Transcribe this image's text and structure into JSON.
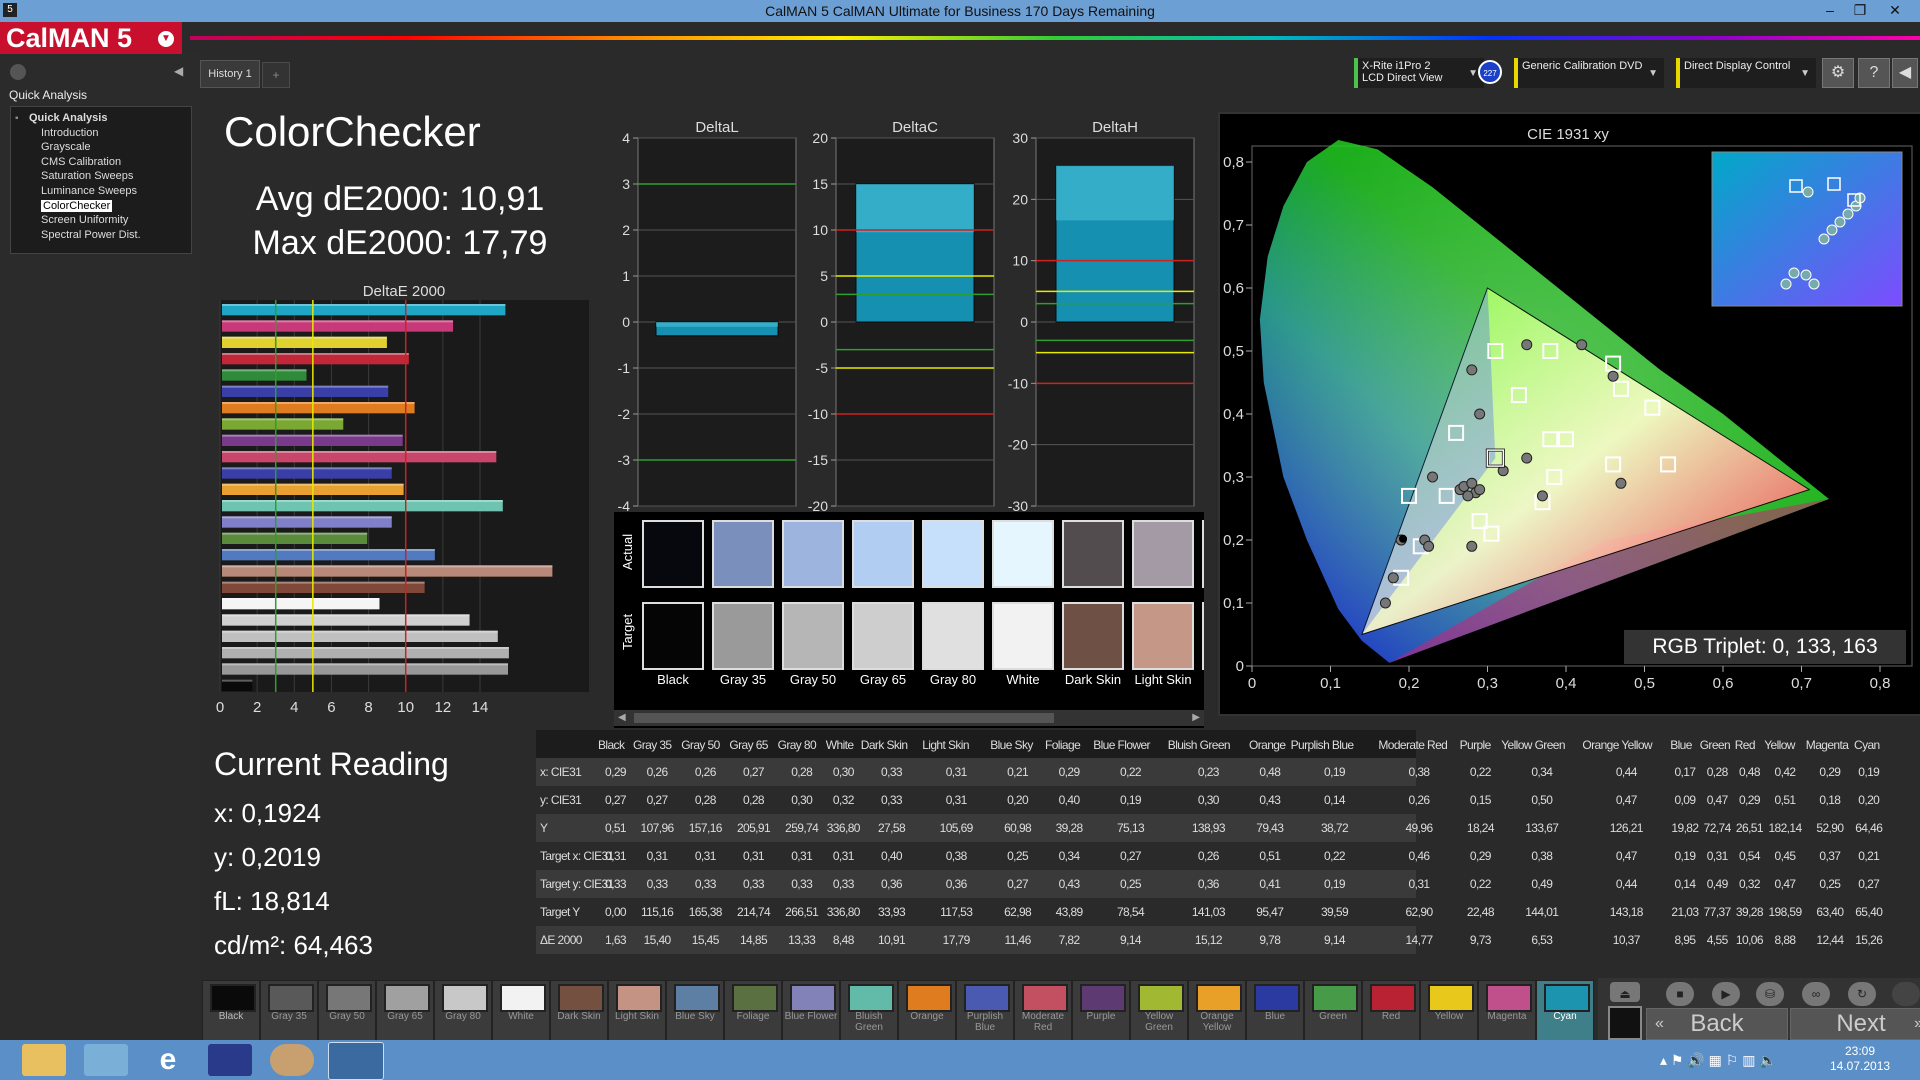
{
  "window": {
    "title": "CalMAN 5 CalMAN Ultimate for Business 170 Days Remaining",
    "app_logo": "CalMAN 5"
  },
  "tabs": [
    {
      "label": "History 1"
    }
  ],
  "sidebar": {
    "header": "Quick Analysis",
    "group": "Quick Analysis",
    "items": [
      {
        "label": "Introduction"
      },
      {
        "label": "Grayscale"
      },
      {
        "label": "CMS Calibration"
      },
      {
        "label": "Saturation Sweeps"
      },
      {
        "label": "Luminance Sweeps"
      },
      {
        "label": "ColorChecker",
        "selected": true
      },
      {
        "label": "Screen Uniformity"
      },
      {
        "label": "Spectral Power Dist."
      }
    ]
  },
  "devices": {
    "meter": {
      "line1": "X-Rite i1Pro 2",
      "line2": "LCD Direct View",
      "badge": "227"
    },
    "source": {
      "label": "Generic Calibration DVD"
    },
    "display": {
      "label": "Direct Display Control"
    }
  },
  "page": {
    "title": "ColorChecker",
    "avg_de": "Avg dE2000: 10,91",
    "max_de": "Max dE2000: 17,79"
  },
  "current_reading": {
    "title": "Current Reading",
    "x": "x: 0,1924",
    "y": "y: 0,2019",
    "fl": "fL: 18,814",
    "cdm2": "cd/m²: 64,463"
  },
  "rgb_triplet": "RGB Triplet: 0, 133, 163",
  "swatches": {
    "actual_label": "Actual",
    "target_label": "Target",
    "items": [
      {
        "name": "Black",
        "actual": "#07080d",
        "target": "#050505"
      },
      {
        "name": "Gray 35",
        "actual": "#7b8fbd",
        "target": "#9a9a9a"
      },
      {
        "name": "Gray 50",
        "actual": "#9db4df",
        "target": "#b6b6b6"
      },
      {
        "name": "Gray 65",
        "actual": "#b2cdf2",
        "target": "#cecece"
      },
      {
        "name": "Gray 80",
        "actual": "#c6e0fc",
        "target": "#e0e0e0"
      },
      {
        "name": "White",
        "actual": "#e5f6ff",
        "target": "#f2f2f2"
      },
      {
        "name": "Dark Skin",
        "actual": "#534c4f",
        "target": "#6e5144"
      },
      {
        "name": "Light Skin",
        "actual": "#a39aa6",
        "target": "#c49787"
      }
    ]
  },
  "chart_data": [
    {
      "type": "bar",
      "title": "DeltaE 2000",
      "orientation": "horizontal",
      "xlim": [
        0,
        15
      ],
      "xticks": [
        "0",
        "2",
        "4",
        "6",
        "8",
        "10",
        "12",
        "14"
      ],
      "reference_lines": [
        {
          "value": 3,
          "color": "#2e9e2e"
        },
        {
          "value": 5,
          "color": "#e8e800"
        },
        {
          "value": 10,
          "color": "#cc2222"
        }
      ],
      "series": [
        {
          "values": [
            1.63,
            15.4,
            15.45,
            14.85,
            13.33,
            8.48,
            10.91,
            17.79,
            11.46,
            7.82,
            9.14,
            15.12,
            9.78,
            9.14,
            14.77,
            9.73,
            6.53,
            10.37,
            8.95,
            4.55,
            10.06,
            8.88,
            12.44,
            15.26
          ]
        }
      ],
      "bar_colors_top_to_bottom": [
        "#1fa6c4",
        "#c8397a",
        "#e0d030",
        "#c0283a",
        "#2f8a3a",
        "#3a3fa8",
        "#e07c20",
        "#7aa832",
        "#7a3a8c",
        "#c8466a",
        "#3a3fa8",
        "#e8a030",
        "#6ec4b0",
        "#8080c8",
        "#5a8a3c",
        "#527ac0",
        "#b88878",
        "#804838",
        "#f5f5f5",
        "#d0d0d0",
        "#c0c0c0",
        "#b0b0b0",
        "#989898",
        "#0a0a0a"
      ],
      "bar_values_top_to_bottom": [
        15.26,
        12.44,
        8.88,
        10.06,
        4.55,
        8.95,
        10.37,
        6.53,
        9.73,
        14.77,
        9.14,
        9.78,
        15.12,
        9.14,
        7.82,
        11.46,
        17.79,
        10.91,
        8.48,
        13.33,
        14.85,
        15.45,
        15.4,
        1.63
      ]
    },
    {
      "type": "bar",
      "title": "DeltaL",
      "ylim": [
        -4,
        4
      ],
      "yticks": [
        "4",
        "3",
        "2",
        "1",
        "0",
        "-1",
        "-2",
        "-3",
        "-4"
      ],
      "values": [
        -0.3
      ],
      "reference_lines": [
        {
          "value": 3,
          "color": "#2e9e2e"
        },
        {
          "value": -3,
          "color": "#2e9e2e"
        }
      ]
    },
    {
      "type": "bar",
      "title": "DeltaC",
      "ylim": [
        -20,
        20
      ],
      "yticks": [
        "20",
        "15",
        "10",
        "5",
        "0",
        "-5",
        "-10",
        "-15",
        "-20"
      ],
      "values": [
        15
      ],
      "reference_lines": [
        {
          "value": 10,
          "color": "#cc2222"
        },
        {
          "value": 5,
          "color": "#e8e800"
        },
        {
          "value": 3,
          "color": "#2e9e2e"
        },
        {
          "value": -3,
          "color": "#2e9e2e"
        },
        {
          "value": -5,
          "color": "#e8e800"
        },
        {
          "value": -10,
          "color": "#cc2222"
        }
      ]
    },
    {
      "type": "bar",
      "title": "DeltaH",
      "ylim": [
        -30,
        30
      ],
      "yticks": [
        "30",
        "20",
        "10",
        "0",
        "-10",
        "-20",
        "-30"
      ],
      "values": [
        25.5
      ],
      "reference_lines": [
        {
          "value": 10,
          "color": "#cc2222"
        },
        {
          "value": 5,
          "color": "#e8e800"
        },
        {
          "value": 3,
          "color": "#2e9e2e"
        },
        {
          "value": -3,
          "color": "#2e9e2e"
        },
        {
          "value": -5,
          "color": "#e8e800"
        },
        {
          "value": -10,
          "color": "#cc2222"
        }
      ]
    },
    {
      "type": "scatter",
      "title": "CIE 1931 xy",
      "xlim": [
        0,
        0.8
      ],
      "ylim": [
        0,
        0.85
      ],
      "xticks": [
        "0",
        "0,1",
        "0,2",
        "0,3",
        "0,4",
        "0,5",
        "0,6",
        "0,7",
        "0,8"
      ],
      "yticks": [
        "0",
        "0,1",
        "0,2",
        "0,3",
        "0,4",
        "0,5",
        "0,6",
        "0,7",
        "0,8"
      ],
      "gamut_primaries": {
        "red": [
          0.71,
          0.28
        ],
        "green": [
          0.3,
          0.6
        ],
        "blue": [
          0.14,
          0.05
        ]
      },
      "targets": [
        [
          0.31,
          0.33
        ],
        [
          0.385,
          0.3
        ],
        [
          0.248,
          0.27
        ],
        [
          0.31,
          0.5
        ],
        [
          0.38,
          0.5
        ],
        [
          0.46,
          0.48
        ],
        [
          0.34,
          0.43
        ],
        [
          0.47,
          0.44
        ],
        [
          0.51,
          0.41
        ],
        [
          0.26,
          0.37
        ],
        [
          0.38,
          0.36
        ],
        [
          0.4,
          0.36
        ],
        [
          0.46,
          0.32
        ],
        [
          0.53,
          0.32
        ],
        [
          0.2,
          0.27
        ],
        [
          0.29,
          0.23
        ],
        [
          0.37,
          0.26
        ],
        [
          0.215,
          0.19
        ],
        [
          0.19,
          0.14
        ],
        [
          0.305,
          0.21
        ]
      ],
      "actuals": [
        [
          0.35,
          0.51
        ],
        [
          0.42,
          0.51
        ],
        [
          0.28,
          0.47
        ],
        [
          0.46,
          0.46
        ],
        [
          0.29,
          0.4
        ],
        [
          0.35,
          0.33
        ],
        [
          0.32,
          0.31
        ],
        [
          0.47,
          0.29
        ],
        [
          0.23,
          0.3
        ],
        [
          0.265,
          0.28
        ],
        [
          0.27,
          0.285
        ],
        [
          0.28,
          0.29
        ],
        [
          0.285,
          0.275
        ],
        [
          0.29,
          0.28
        ],
        [
          0.19,
          0.2
        ],
        [
          0.22,
          0.2
        ],
        [
          0.18,
          0.14
        ],
        [
          0.225,
          0.19
        ],
        [
          0.17,
          0.1
        ],
        [
          0.28,
          0.19
        ],
        [
          0.37,
          0.27
        ],
        [
          0.19,
          0.2
        ],
        [
          0.275,
          0.27
        ]
      ],
      "current_point": [
        0.1924,
        0.2019
      ],
      "current_target": [
        0.31,
        0.33
      ]
    }
  ],
  "table": {
    "columns": [
      "Black",
      "Gray 35",
      "Gray 50",
      "Gray 65",
      "Gray 80",
      "White",
      "Dark Skin",
      "Light Skin",
      "Blue Sky",
      "Foliage",
      "Blue Flower",
      "Bluish Green",
      "Orange",
      "Purplish Blue",
      "Moderate Red",
      "Purple",
      "Yellow Green",
      "Orange Yellow",
      "Blue",
      "Green",
      "Red",
      "Yellow",
      "Magenta",
      "Cyan"
    ],
    "rows": [
      {
        "label": "x: CIE31",
        "values": [
          "0,29",
          "0,26",
          "0,26",
          "0,27",
          "0,28",
          "0,30",
          "0,33",
          "0,31",
          "0,21",
          "0,29",
          "0,22",
          "0,23",
          "0,48",
          "0,19",
          "0,38",
          "0,22",
          "0,34",
          "0,44",
          "0,17",
          "0,28",
          "0,48",
          "0,42",
          "0,29",
          "0,19"
        ]
      },
      {
        "label": "y: CIE31",
        "values": [
          "0,27",
          "0,27",
          "0,28",
          "0,28",
          "0,30",
          "0,32",
          "0,33",
          "0,31",
          "0,20",
          "0,40",
          "0,19",
          "0,30",
          "0,43",
          "0,14",
          "0,26",
          "0,15",
          "0,50",
          "0,47",
          "0,09",
          "0,47",
          "0,29",
          "0,51",
          "0,18",
          "0,20"
        ]
      },
      {
        "label": "Y",
        "values": [
          "0,51",
          "107,96",
          "157,16",
          "205,91",
          "259,74",
          "336,80",
          "27,58",
          "105,69",
          "60,98",
          "39,28",
          "75,13",
          "138,93",
          "79,43",
          "38,72",
          "49,96",
          "18,24",
          "133,67",
          "126,21",
          "19,82",
          "72,74",
          "26,51",
          "182,14",
          "52,90",
          "64,46"
        ]
      },
      {
        "label": "Target x: CIE31",
        "values": [
          "0,31",
          "0,31",
          "0,31",
          "0,31",
          "0,31",
          "0,31",
          "0,40",
          "0,38",
          "0,25",
          "0,34",
          "0,27",
          "0,26",
          "0,51",
          "0,22",
          "0,46",
          "0,29",
          "0,38",
          "0,47",
          "0,19",
          "0,31",
          "0,54",
          "0,45",
          "0,37",
          "0,21"
        ]
      },
      {
        "label": "Target y: CIE31",
        "values": [
          "0,33",
          "0,33",
          "0,33",
          "0,33",
          "0,33",
          "0,33",
          "0,36",
          "0,36",
          "0,27",
          "0,43",
          "0,25",
          "0,36",
          "0,41",
          "0,19",
          "0,31",
          "0,22",
          "0,49",
          "0,44",
          "0,14",
          "0,49",
          "0,32",
          "0,47",
          "0,25",
          "0,27"
        ]
      },
      {
        "label": "Target Y",
        "values": [
          "0,00",
          "115,16",
          "165,38",
          "214,74",
          "266,51",
          "336,80",
          "33,93",
          "117,53",
          "62,98",
          "43,89",
          "78,54",
          "141,03",
          "95,47",
          "39,59",
          "62,90",
          "22,48",
          "144,01",
          "143,18",
          "21,03",
          "77,37",
          "39,28",
          "198,59",
          "63,40",
          "65,40"
        ]
      },
      {
        "label": "ΔE 2000",
        "values": [
          "1,63",
          "15,40",
          "15,45",
          "14,85",
          "13,33",
          "8,48",
          "10,91",
          "17,79",
          "11,46",
          "7,82",
          "9,14",
          "15,12",
          "9,78",
          "9,14",
          "14,77",
          "9,73",
          "6,53",
          "10,37",
          "8,95",
          "4,55",
          "10,06",
          "8,88",
          "12,44",
          "15,26"
        ]
      }
    ]
  },
  "palette": [
    {
      "label": "Black",
      "color": "#0a0a0a"
    },
    {
      "label": "Gray 35",
      "color": "#595959"
    },
    {
      "label": "Gray 50",
      "color": "#777777"
    },
    {
      "label": "Gray 65",
      "color": "#a0a0a0"
    },
    {
      "label": "Gray 80",
      "color": "#c8c8c8"
    },
    {
      "label": "White",
      "color": "#f2f2f2"
    },
    {
      "label": "Dark Skin",
      "color": "#73503f"
    },
    {
      "label": "Light Skin",
      "color": "#c49383"
    },
    {
      "label": "Blue Sky",
      "color": "#5e7fa4"
    },
    {
      "label": "Foliage",
      "color": "#5a7040"
    },
    {
      "label": "Blue Flower",
      "color": "#8282b8"
    },
    {
      "label": "Bluish Green",
      "color": "#62bba9"
    },
    {
      "label": "Orange",
      "color": "#e07c20"
    },
    {
      "label": "Purplish Blue",
      "color": "#4a5ab0"
    },
    {
      "label": "Moderate Red",
      "color": "#c25060"
    },
    {
      "label": "Purple",
      "color": "#5e3a72"
    },
    {
      "label": "Yellow Green",
      "color": "#a0b832"
    },
    {
      "label": "Orange Yellow",
      "color": "#e8a028"
    },
    {
      "label": "Blue",
      "color": "#2a3aa0"
    },
    {
      "label": "Green",
      "color": "#469a48"
    },
    {
      "label": "Red",
      "color": "#b82232"
    },
    {
      "label": "Yellow",
      "color": "#e8c81a"
    },
    {
      "label": "Magenta",
      "color": "#c0508c"
    },
    {
      "label": "Cyan",
      "color": "#1c94b0",
      "active": true
    }
  ],
  "nav": {
    "back": "Back",
    "next": "Next"
  },
  "clock": {
    "time": "23:09",
    "date": "14.07.2013"
  }
}
